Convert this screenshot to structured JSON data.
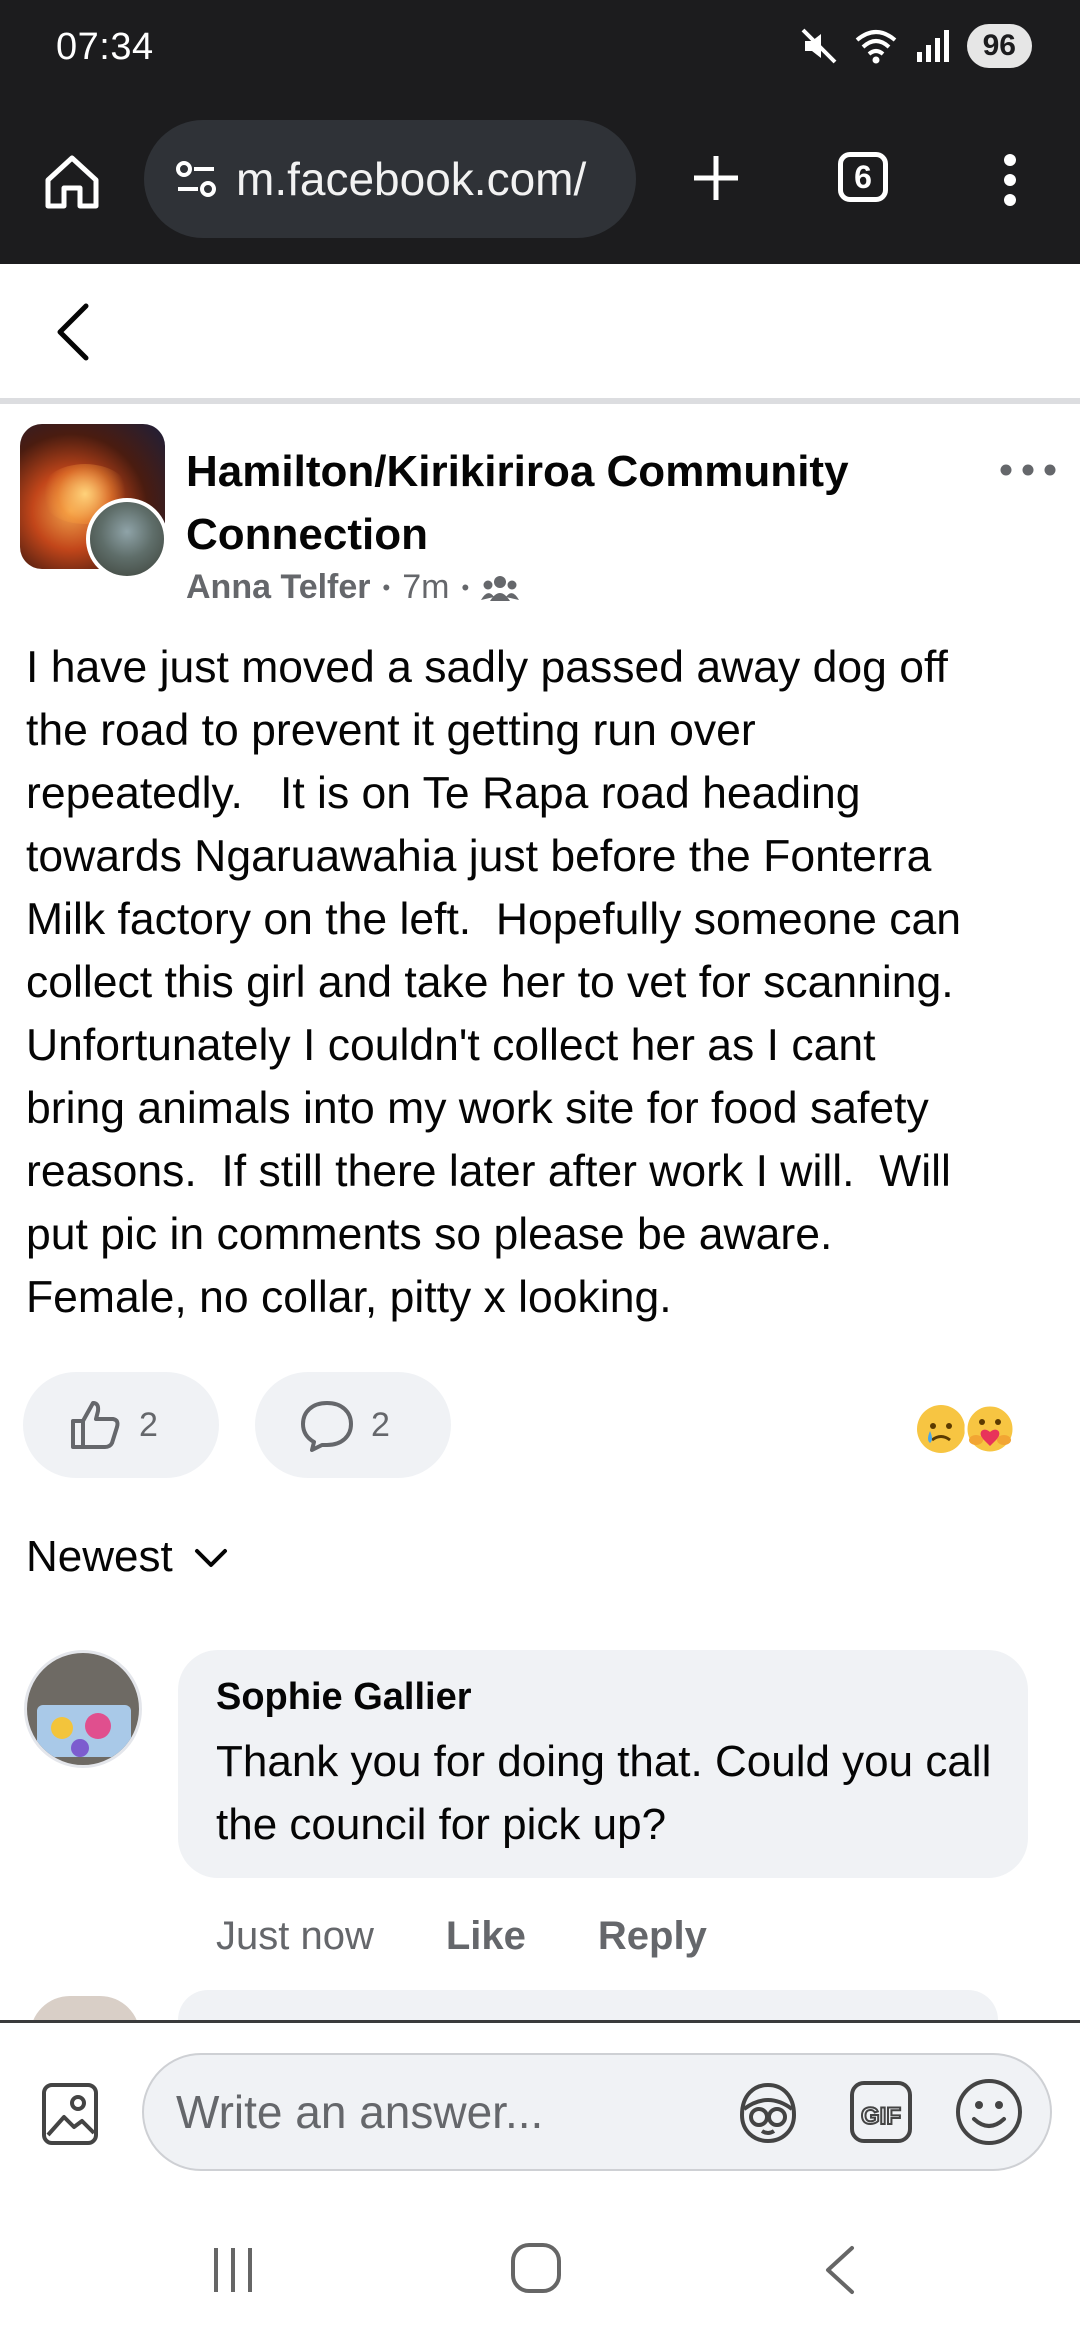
{
  "status_bar": {
    "time": "07:34",
    "battery": "96"
  },
  "browser": {
    "url": "m.facebook.com/",
    "tab_count": "6"
  },
  "post": {
    "group_name": "Hamilton/Kirikiriroa Community Connection",
    "author": "Anna Telfer",
    "time": "7m",
    "body": "I have just moved a sadly passed away dog off\nthe road to prevent it getting run over\nrepeatedly.   It is on Te Rapa road heading\ntowards Ngaruawahia just before the Fonterra\nMilk factory on the left.  Hopefully someone can\ncollect this girl and take her to vet for scanning.\nUnfortunately I couldn't collect her as I cant\nbring animals into my work site for food safety\nreasons.  If still there later after work I will.  Will\nput pic in comments so please be aware.\nFemale, no collar, pitty x looking.",
    "like_count": "2",
    "comment_count": "2",
    "reactions": [
      "sad",
      "care"
    ]
  },
  "comments": {
    "sort_label": "Newest",
    "items": [
      {
        "author": "Sophie Gallier",
        "text": "Thank you for doing that. Could you call the council for pick up?",
        "time": "Just now",
        "like_label": "Like",
        "reply_label": "Reply"
      }
    ]
  },
  "composer": {
    "placeholder": "Write an answer..."
  },
  "icons": {
    "accent": "#1c1c1e",
    "muted": "#65676b",
    "bubble_bg": "#f0f2f5"
  }
}
